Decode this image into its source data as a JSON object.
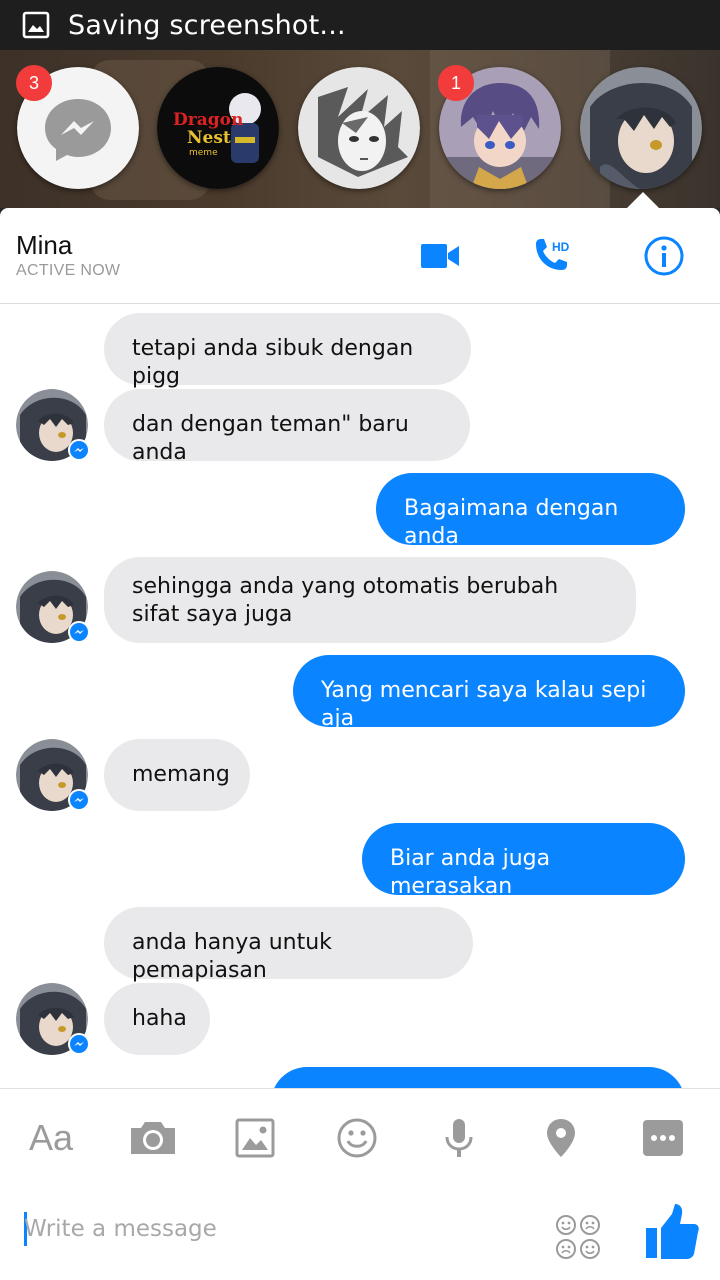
{
  "status_bar": {
    "icon": "image-icon",
    "text": "Saving screenshot..."
  },
  "chat_heads": [
    {
      "name": "messenger-head",
      "badge": "3"
    },
    {
      "name": "dragon-nest-head",
      "label_line1": "Dragon",
      "label_line2": "Nest",
      "label_line3": "meme"
    },
    {
      "name": "manga-boy-head"
    },
    {
      "name": "purple-hair-head",
      "badge": "1"
    },
    {
      "name": "mina-head"
    }
  ],
  "conversation": {
    "name": "Mina",
    "status": "ACTIVE NOW"
  },
  "header_actions": {
    "video": "video-camera-icon",
    "call": "phone-hd-icon",
    "call_badge": "HD",
    "info": "info-icon"
  },
  "messages": [
    {
      "dir": "in",
      "text": "tetapi anda sibuk dengan pigg"
    },
    {
      "dir": "in",
      "text": "dan dengan teman\" baru anda"
    },
    {
      "dir": "out",
      "text": "Bagaimana dengan anda"
    },
    {
      "dir": "in",
      "text": "sehingga anda yang otomatis berubah\nsifat saya juga"
    },
    {
      "dir": "out",
      "text": "Yang mencari saya kalau sepi aja"
    },
    {
      "dir": "in",
      "text": "memang"
    },
    {
      "dir": "out",
      "text": "Biar anda juga merasakan"
    },
    {
      "dir": "in",
      "text": "anda hanya untuk pemapiasan"
    },
    {
      "dir": "in",
      "text": "haha"
    },
    {
      "dir": "out",
      "text": ""
    }
  ],
  "toolbar": {
    "text_tool": "Aa",
    "items": [
      "text-format-icon",
      "camera-icon",
      "gallery-icon",
      "emoji-icon",
      "microphone-icon",
      "location-icon",
      "more-icon"
    ]
  },
  "composer": {
    "placeholder": "Write a message"
  },
  "colors": {
    "accent": "#0a84ff",
    "incoming": "#e9e9eb",
    "badge": "#f23c3c"
  }
}
